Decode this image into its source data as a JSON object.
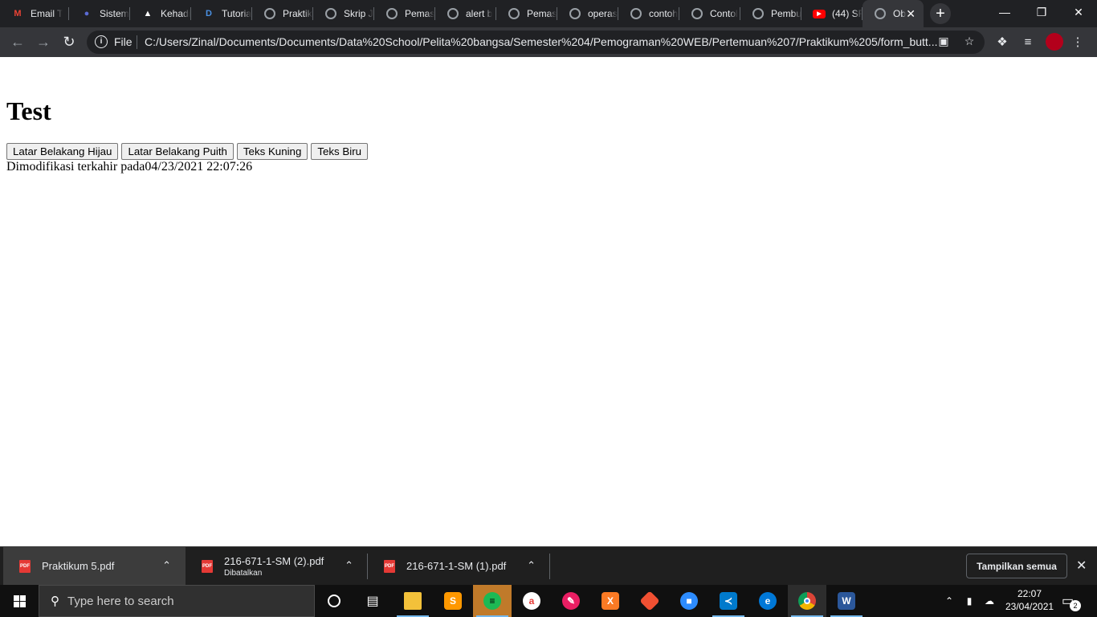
{
  "browser": {
    "tabs": [
      {
        "title": "Email T",
        "icon": "gmail-icon"
      },
      {
        "title": "Sistem",
        "icon": "site-icon"
      },
      {
        "title": "Kehadi",
        "icon": "site-icon"
      },
      {
        "title": "Tutoria",
        "icon": "site-icon"
      },
      {
        "title": "Praktik",
        "icon": "globe-icon"
      },
      {
        "title": "Skrip J",
        "icon": "globe-icon"
      },
      {
        "title": "Pemas",
        "icon": "globe-icon"
      },
      {
        "title": "alert b",
        "icon": "globe-icon"
      },
      {
        "title": "Pemas",
        "icon": "globe-icon"
      },
      {
        "title": "operas",
        "icon": "globe-icon"
      },
      {
        "title": "contoh",
        "icon": "globe-icon"
      },
      {
        "title": "Contol",
        "icon": "globe-icon"
      },
      {
        "title": "Pembu",
        "icon": "globe-icon"
      },
      {
        "title": "(44) SF",
        "icon": "youtube-icon"
      },
      {
        "title": "Ob",
        "icon": "globe-icon"
      }
    ],
    "address": {
      "scheme_label": "File",
      "url": "C:/Users/Zinal/Documents/Documents/Data%20School/Pelita%20bangsa/Semester%204/Pemograman%20WEB/Pertemuan%207/Praktikum%205/form_butt..."
    }
  },
  "page": {
    "heading": "Test",
    "buttons": [
      "Latar Belakang Hijau",
      "Latar Belakang Puith",
      "Teks Kuning",
      "Teks Biru"
    ],
    "modified_text": "Dimodifikasi terkahir pada04/23/2021 22:07:26"
  },
  "downloads": {
    "items": [
      {
        "filename": "Praktikum 5.pdf",
        "status": ""
      },
      {
        "filename": "216-671-1-SM (2).pdf",
        "status": "Dibatalkan"
      },
      {
        "filename": "216-671-1-SM (1).pdf",
        "status": ""
      }
    ],
    "show_all_label": "Tampilkan semua"
  },
  "taskbar": {
    "search_placeholder": "Type here to search",
    "time": "22:07",
    "date": "23/04/2021",
    "notification_count": "2"
  }
}
